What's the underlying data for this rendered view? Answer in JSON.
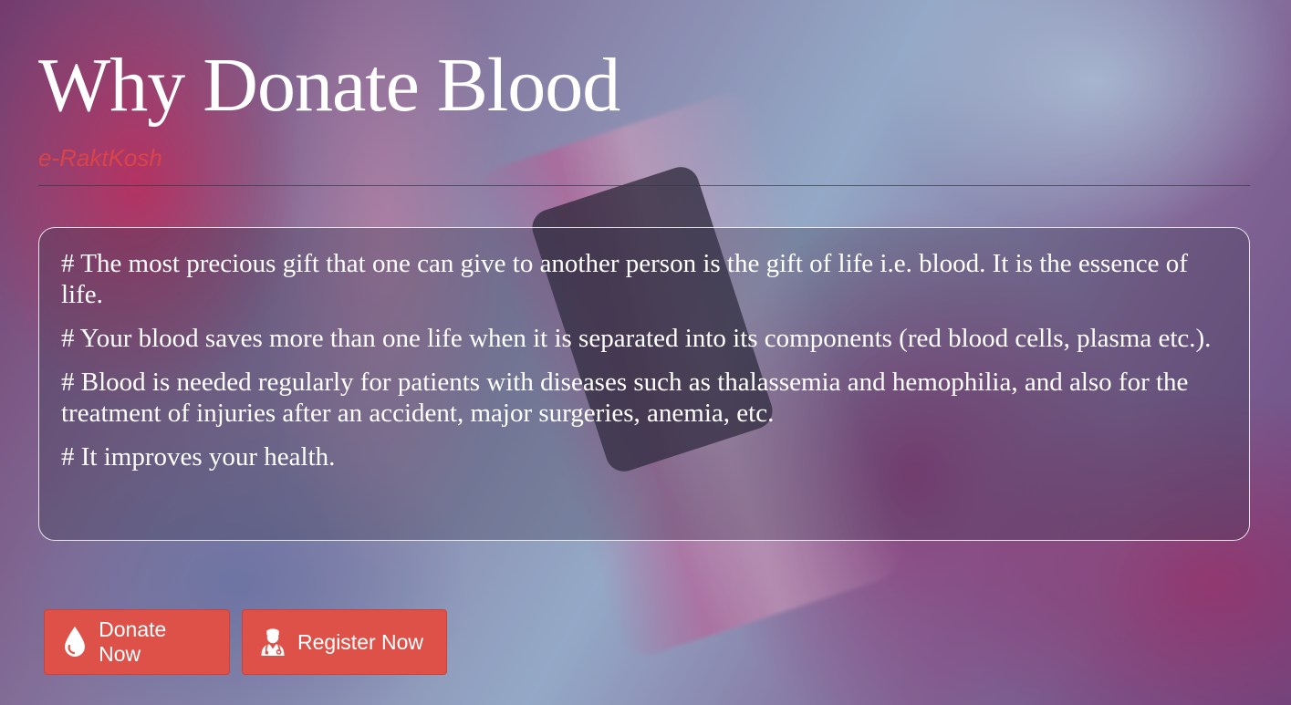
{
  "hero": {
    "title": "Why Donate Blood",
    "subtitle": "e-RaktKosh"
  },
  "facts": [
    "# The most precious gift that one can give to another person is the gift of life i.e. blood. It is the essence of life.",
    "# Your blood saves more than one life when it is separated into its components (red blood cells, plasma etc.).",
    "# Blood is needed regularly for patients with diseases such as thalassemia and hemophilia, and also for the treatment of injuries after an accident, major surgeries, anemia, etc.",
    "# It improves your health."
  ],
  "actions": {
    "donate": {
      "label": "Donate Now",
      "icon": "blood-drop-icon"
    },
    "register": {
      "label": "Register Now",
      "icon": "user-doctor-icon"
    }
  },
  "colors": {
    "accent": "#de5149",
    "subtitle": "#d9444a",
    "text": "#ffffff"
  }
}
